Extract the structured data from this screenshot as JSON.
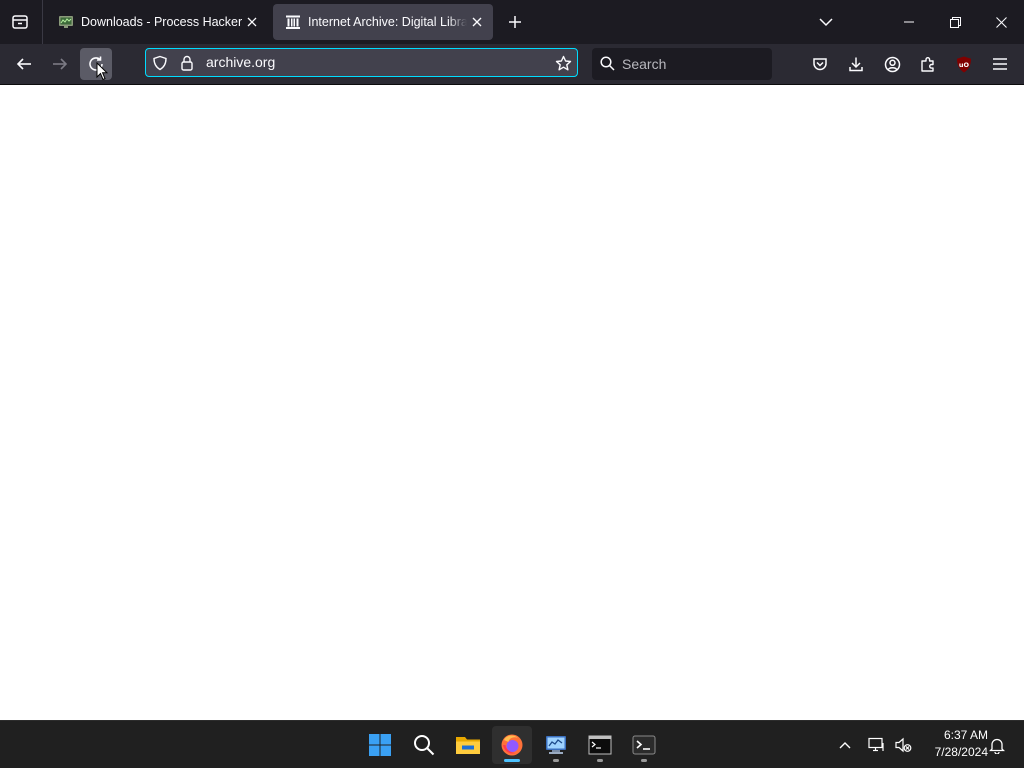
{
  "tabs": [
    {
      "title": "Downloads - Process Hacker",
      "icon": "process-hacker-icon",
      "active": false
    },
    {
      "title": "Internet Archive: Digital Library of Free & Borrowable Books",
      "icon": "archive-building-icon",
      "active": true
    }
  ],
  "navbar": {
    "url": "archive.org",
    "search_placeholder": "Search"
  },
  "taskbar": {
    "apps": [
      "start-icon",
      "search-icon",
      "file-explorer-icon",
      "firefox-icon",
      "control-panel-icon",
      "command-prompt-icon",
      "terminal-icon"
    ],
    "time": "6:37 AM",
    "date": "7/28/2024"
  },
  "colors": {
    "accent": "#00ddff",
    "tab_bar": "#1c1b22",
    "toolbar": "#2b2a33",
    "taskbar": "#202020",
    "taskbar_indicator": "#4cc2ff"
  }
}
